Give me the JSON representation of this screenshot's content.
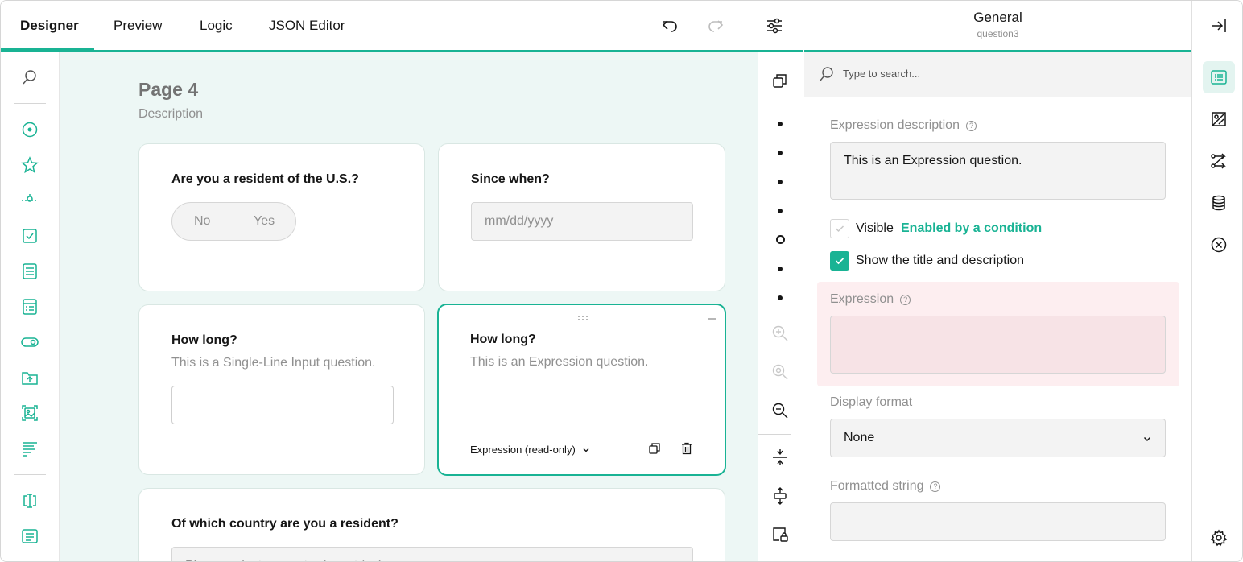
{
  "tabs": [
    {
      "label": "Designer",
      "active": true
    },
    {
      "label": "Preview",
      "active": false
    },
    {
      "label": "Logic",
      "active": false
    },
    {
      "label": "JSON Editor",
      "active": false
    }
  ],
  "toolbar_icons": [
    "undo-icon",
    "redo-icon",
    "settings-sliders-icon"
  ],
  "toolbox_icons": [
    "search-icon",
    "radiogroup-icon",
    "rating-icon",
    "slider-icon",
    "checkbox-icon",
    "dropdown-icon",
    "tagbox-icon",
    "boolean-toggle-icon",
    "file-upload-icon",
    "image-picker-icon",
    "ranking-icon",
    "text-input-icon",
    "comment-icon"
  ],
  "canvas": {
    "page_title": "Page 4",
    "page_description": "Description",
    "questions": [
      {
        "title": "Are you a resident of the U.S.?",
        "bool_false": "No",
        "bool_true": "Yes"
      },
      {
        "title": "Since when?",
        "placeholder": "mm/dd/yyyy"
      },
      {
        "title": "How long?",
        "description": "This is a Single-Line Input question."
      },
      {
        "title": "How long?",
        "description": "This is an Expression question.",
        "type_label": "Expression (read-only)"
      },
      {
        "title": "Of which country are you a resident?",
        "placeholder": "Please select a country (countries)..."
      }
    ]
  },
  "property_grid": {
    "title": "General",
    "subtitle": "question3",
    "search_placeholder": "Type to search...",
    "expression_description_label": "Expression description",
    "expression_description_value": "This is an Expression question.",
    "visible_label": "Visible",
    "visible_link": "Enabled by a condition",
    "show_title_label": "Show the title and description",
    "expression_label": "Expression",
    "display_format_label": "Display format",
    "display_format_value": "None",
    "formatted_string_label": "Formatted string"
  },
  "accent_color": "#19b394",
  "error_color": "#fdeef0"
}
